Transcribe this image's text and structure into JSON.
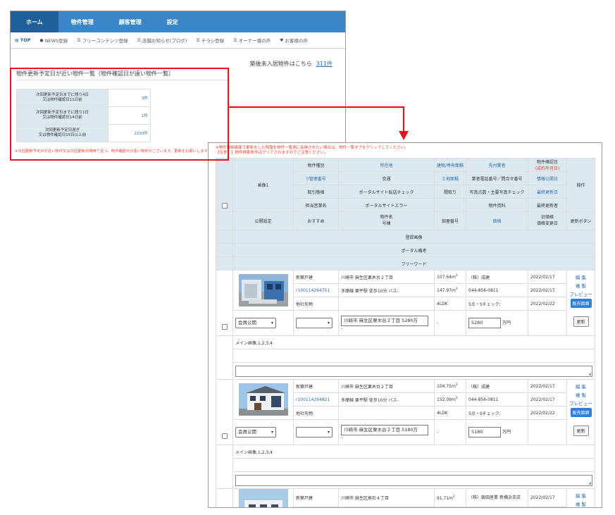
{
  "nav": {
    "main": [
      "ホーム",
      "物件管理",
      "顧客管理",
      "設定"
    ],
    "sub": [
      {
        "icon": "monitor-icon",
        "glyph": "▤",
        "label": "TOP"
      },
      {
        "icon": "speech-icon",
        "glyph": "●",
        "label": "NEWS登録"
      },
      {
        "icon": "list-icon",
        "glyph": "☰",
        "label": "フリーコンテンツ登録"
      },
      {
        "icon": "list-icon",
        "glyph": "☰",
        "label": "店舗お知らせ(ブログ)"
      },
      {
        "icon": "list-icon",
        "glyph": "☰",
        "label": "チラシ登録"
      },
      {
        "icon": "list-icon",
        "glyph": "☰",
        "label": "オーナー様の声"
      },
      {
        "icon": "heart-icon",
        "glyph": "♥",
        "label": "お客様の声"
      }
    ]
  },
  "vacancy": {
    "text": "築後未入居物件はこちら",
    "count": "311件"
  },
  "section_title": "物件更新予定日が近い物件一覧（物件確認日が遠い物件一覧）",
  "update_rows": [
    {
      "line1": "次回更新予定日までに残り4日",
      "line2": "又は物件確認日11日前",
      "count": "3件"
    },
    {
      "line1": "次回更新予定日までに残り1日",
      "line2": "又は物件確認日14日前",
      "count": "1件"
    },
    {
      "line1": "次回更新予定日遅ぎ",
      "line2": "又は物件確認日15日以上前",
      "count": "2293件"
    }
  ],
  "warn1": "※次回更新予定日が近い物件又は次回更新日随時て且つ、物件確認日が遠い物件がございます。更新をお願いします",
  "warn2": {
    "line1": "※物件詳細画面で更新をした情報を物件一覧側に反映されたい場合は、物件一覧タブをクリックしてください。",
    "line2": "【注意！】物件検索条件はクリアされますのでご注意ください。"
  },
  "table_header": {
    "image1": "画像1",
    "kind": "物件種別",
    "location": "所在地",
    "area": "建物/専有面積",
    "agent": "先付業者",
    "checkdate": "物件確認日",
    "checkdate_sub": "(成約年月日)",
    "ops": "操作",
    "mgmt_no": "▽管理番号",
    "traffic": "交通",
    "land_area": "土地面積",
    "agent_phone": "業者電話番号／問合せ番号",
    "info_pub_date": "情報公開日",
    "trade": "取引態様",
    "portal_check": "ポータルサイト転送チェック",
    "layout": "間取り",
    "photo_check": "写真点数・主要写真チェック",
    "last_update": "最終更新日",
    "staff": "担当営業名",
    "portal_error": "ポータルサイトエラー",
    "material": "物件資料",
    "last_updater": "最終更新者",
    "pub_setting": "公開設定",
    "recommend": "おすすめ",
    "name": "物件名",
    "room": "号棟",
    "room_no": "部屋番号",
    "price": "価格",
    "old_price": "旧価格",
    "price_change": "価格変更日",
    "update_btn": "更新ボタン",
    "reg_image": "登録画像",
    "portal_remark": "ポータル備考",
    "free_word": "フリーワード"
  },
  "properties": [
    {
      "kind": "新築戸建",
      "address": "川崎市 麻生区栗木台２丁目",
      "building_area": "107.64m",
      "agent": "（株）成建",
      "date1": "2022/02/17",
      "mgmt": "r100114264751",
      "traffic": "多摩線 栗平駅 徒歩10分 バス-",
      "land_area": "147.97m",
      "phone": "044-856-0811",
      "date2": "2022/02/17",
      "trade": "他社先物",
      "layout": "4LDK",
      "photo": "5点・Sチェック:",
      "date3": "2022/02/22",
      "pub": "会員公開",
      "name_input": "川崎市 麻生区栗木台２丁目 5280万",
      "name_sub": "-",
      "room_no": "-",
      "price": "5280",
      "unit": "万円",
      "images": "メイン画像,1,2,3,4"
    },
    {
      "kind": "新築戸建",
      "address": "川崎市 麻生区栗木台２丁目",
      "building_area": "104.75m",
      "agent": "（株）成建",
      "date1": "2022/02/17",
      "mgmt": "r100114264821",
      "traffic": "多摩線 栗平駅 徒歩10分 バス-",
      "land_area": "152.09m",
      "phone": "044-856-0811",
      "date2": "2022/02/17",
      "trade": "他社先物",
      "layout": "4LDK",
      "photo": "5点・Sチェック:",
      "date3": "2022/02/22",
      "pub": "会員公開",
      "name_input": "川崎市 麻生区栗木台２丁目 5180万",
      "name_sub": "-",
      "room_no": "-",
      "price": "5180",
      "unit": "万円",
      "images": "メイン画像,1,2,3,4"
    },
    {
      "kind": "新築戸建",
      "address": "川崎市 麻生区高石４丁目",
      "building_area": "91.71m",
      "agent": "（株）飯田産業 新横浜支店",
      "date1": "2022/02/17"
    }
  ],
  "actions": {
    "edit": "編 集",
    "copy": "複 製",
    "preview": "プレビュー",
    "sale": "販売図面",
    "update": "更新"
  },
  "colors": {
    "nav": "#3a86c8",
    "nav_active": "#1f5f9a",
    "header_bg": "#dbe8ef",
    "highlight": "#e8141c",
    "link": "#2a6db3",
    "warning": "#ee4433"
  }
}
